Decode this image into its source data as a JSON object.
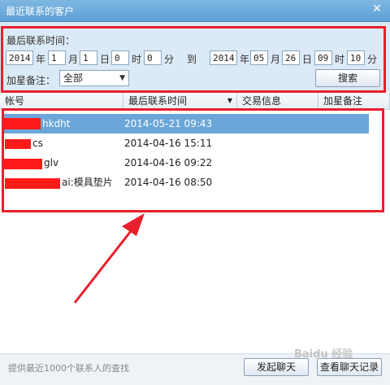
{
  "window": {
    "title": "最近联系的客户",
    "close_glyph": "✕"
  },
  "filter": {
    "heading": "最后联系时间：",
    "from": {
      "year": "2014",
      "year_unit": "年",
      "month": "1",
      "month_unit": "月",
      "day": "1",
      "day_unit": "日",
      "hour": "0",
      "hour_unit": "时",
      "minute": "0",
      "minute_unit": "分"
    },
    "to_label": "到",
    "to": {
      "year": "2014",
      "year_unit": "年",
      "month": "05",
      "month_unit": "月",
      "day": "26",
      "day_unit": "日",
      "hour": "09",
      "hour_unit": "时",
      "minute": "10",
      "minute_unit": "分"
    },
    "star_label": "加星备注：",
    "star_select": "全部",
    "search_button": "搜索"
  },
  "table": {
    "columns": [
      "帐号",
      "最后联系时间",
      "交易信息",
      "加星备注"
    ],
    "rows": [
      {
        "account": "hkdht",
        "time": "2014-05-21 09:43",
        "selected": true
      },
      {
        "account": "cs",
        "time": "2014-04-16 15:11",
        "selected": false
      },
      {
        "account": "glv",
        "time": "2014-04-16 09:22",
        "selected": false
      },
      {
        "account": "ai:模具垫片",
        "time": "2014-04-16 08:50",
        "selected": false
      }
    ]
  },
  "footer": {
    "hint": "提供最近1000个联系人的查找",
    "chat_button": "发起聊天",
    "history_button": "查看聊天记录"
  },
  "watermark": "Baidu 经验",
  "colors": {
    "titlebar": "#5d9fd6",
    "selection": "#6aa6d8",
    "annotation": "#e81f2c"
  }
}
